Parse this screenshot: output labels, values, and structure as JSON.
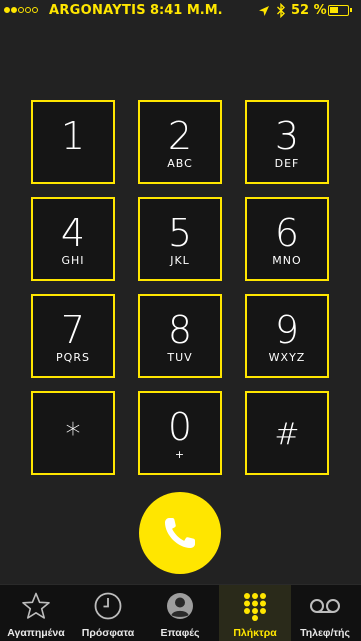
{
  "status_bar": {
    "signal_bars_filled": 2,
    "signal_bars_total": 5,
    "carrier": "ARGONAYTIS",
    "time": "8:41 Μ.Μ.",
    "battery_text": "52 %",
    "battery_level": 0.52
  },
  "keypad": [
    {
      "digit": "1",
      "letters": ""
    },
    {
      "digit": "2",
      "letters": "ABC"
    },
    {
      "digit": "3",
      "letters": "DEF"
    },
    {
      "digit": "4",
      "letters": "GHI"
    },
    {
      "digit": "5",
      "letters": "JKL"
    },
    {
      "digit": "6",
      "letters": "MNO"
    },
    {
      "digit": "7",
      "letters": "PQRS"
    },
    {
      "digit": "8",
      "letters": "TUV"
    },
    {
      "digit": "9",
      "letters": "WXYZ"
    },
    {
      "digit": "*",
      "letters": ""
    },
    {
      "digit": "0",
      "letters": "+"
    },
    {
      "digit": "#",
      "letters": ""
    }
  ],
  "tabs": [
    {
      "label": "Αγαπημένα",
      "icon": "star-icon"
    },
    {
      "label": "Πρόσφατα",
      "icon": "clock-icon"
    },
    {
      "label": "Επαφές",
      "icon": "contacts-icon"
    },
    {
      "label": "Πλήκτρα",
      "icon": "keypad-icon",
      "active": true
    },
    {
      "label": "Τηλεφ/τής",
      "icon": "voicemail-icon"
    }
  ],
  "colors": {
    "accent": "#FFE600",
    "background": "#222222",
    "key_background": "#151515",
    "tab_bar": "#111111"
  }
}
